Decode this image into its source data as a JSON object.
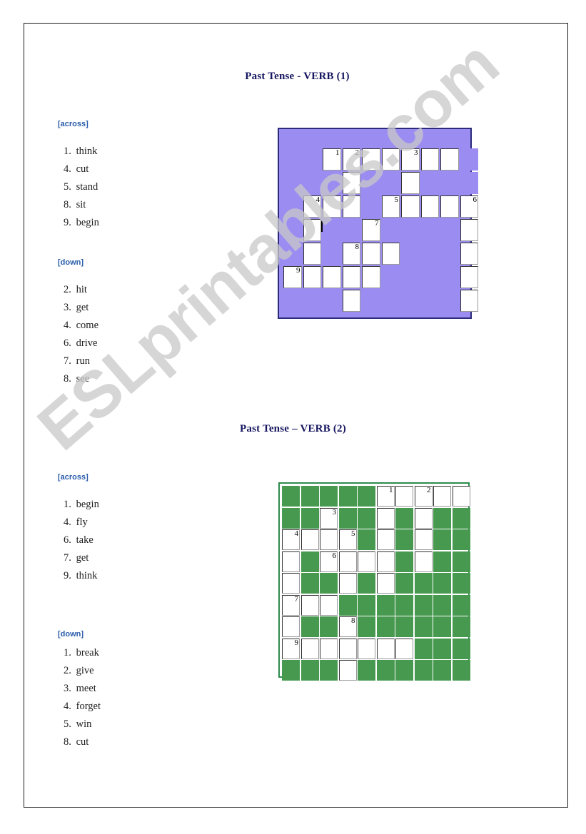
{
  "document": {
    "watermark": "ESLprintables.com"
  },
  "sections": [
    {
      "title": "Past Tense - VERB (1)",
      "across_heading": "[across]",
      "down_heading": "[down]",
      "across": [
        {
          "num": "1.",
          "word": "think"
        },
        {
          "num": "4.",
          "word": "cut"
        },
        {
          "num": "5.",
          "word": "stand"
        },
        {
          "num": "8.",
          "word": "sit"
        },
        {
          "num": "9.",
          "word": "begin"
        }
      ],
      "down": [
        {
          "num": "2.",
          "word": "hit"
        },
        {
          "num": "3.",
          "word": "get"
        },
        {
          "num": "4.",
          "word": "come"
        },
        {
          "num": "6.",
          "word": "drive"
        },
        {
          "num": "7.",
          "word": "run"
        },
        {
          "num": "8.",
          "word": "see"
        }
      ],
      "grid": {
        "color": "#9b8cf2",
        "border_color": "#2b2b7a",
        "rows": 7,
        "cols": 10,
        "cells": [
          [
            "b",
            "b",
            "w1",
            "w2",
            "w",
            "w",
            "w3",
            "w",
            "w",
            "b"
          ],
          [
            "b",
            "b",
            "b",
            "w",
            "b",
            "b",
            "w",
            "b",
            "b",
            "b"
          ],
          [
            "b",
            "w4",
            "w",
            "w",
            "b",
            "w5",
            "w",
            "w",
            "w",
            "w6"
          ],
          [
            "b",
            "wc",
            "b",
            "b",
            "w7",
            "b",
            "b",
            "b",
            "b",
            "w"
          ],
          [
            "b",
            "w",
            "b",
            "w8",
            "w",
            "w",
            "b",
            "b",
            "b",
            "w"
          ],
          [
            "w9",
            "w",
            "w",
            "w",
            "w",
            "b",
            "b",
            "b",
            "b",
            "w"
          ],
          [
            "b",
            "b",
            "b",
            "w",
            "b",
            "b",
            "b",
            "b",
            "b",
            "w"
          ]
        ]
      }
    },
    {
      "title": "Past Tense – VERB (2)",
      "across_heading": "[across]",
      "down_heading": "[down]",
      "across": [
        {
          "num": "1.",
          "word": "begin"
        },
        {
          "num": "4.",
          "word": "fly"
        },
        {
          "num": "6.",
          "word": "take"
        },
        {
          "num": "7.",
          "word": "get"
        },
        {
          "num": "9.",
          "word": "think"
        }
      ],
      "down": [
        {
          "num": "1.",
          "word": "break"
        },
        {
          "num": "2.",
          "word": "give"
        },
        {
          "num": "3.",
          "word": "meet"
        },
        {
          "num": "4.",
          "word": "forget"
        },
        {
          "num": "5.",
          "word": "win"
        },
        {
          "num": "8.",
          "word": "cut"
        }
      ],
      "grid": {
        "color": "#46994f",
        "border_color": "#2e8b4f",
        "rows": 9,
        "cols": 10,
        "cells": [
          [
            "b",
            "b",
            "b",
            "b",
            "b",
            "w1",
            "w",
            "w2",
            "w",
            "w"
          ],
          [
            "b",
            "b",
            "w3",
            "b",
            "b",
            "w",
            "b",
            "w",
            "b",
            "b"
          ],
          [
            "w4",
            "w",
            "w",
            "w5",
            "b",
            "w",
            "b",
            "w",
            "b",
            "b"
          ],
          [
            "w",
            "b",
            "w6",
            "w",
            "w",
            "w",
            "b",
            "w",
            "b",
            "b"
          ],
          [
            "w",
            "b",
            "b",
            "w",
            "b",
            "w",
            "b",
            "b",
            "b",
            "b"
          ],
          [
            "w7",
            "w",
            "w",
            "b",
            "b",
            "b",
            "b",
            "b",
            "b",
            "b"
          ],
          [
            "w",
            "b",
            "b",
            "w8",
            "b",
            "b",
            "b",
            "b",
            "b",
            "b"
          ],
          [
            "w9",
            "w",
            "w",
            "w",
            "w",
            "w",
            "w",
            "b",
            "b",
            "b"
          ],
          [
            "b",
            "b",
            "b",
            "w",
            "b",
            "b",
            "b",
            "b",
            "b",
            "b"
          ]
        ]
      }
    }
  ]
}
